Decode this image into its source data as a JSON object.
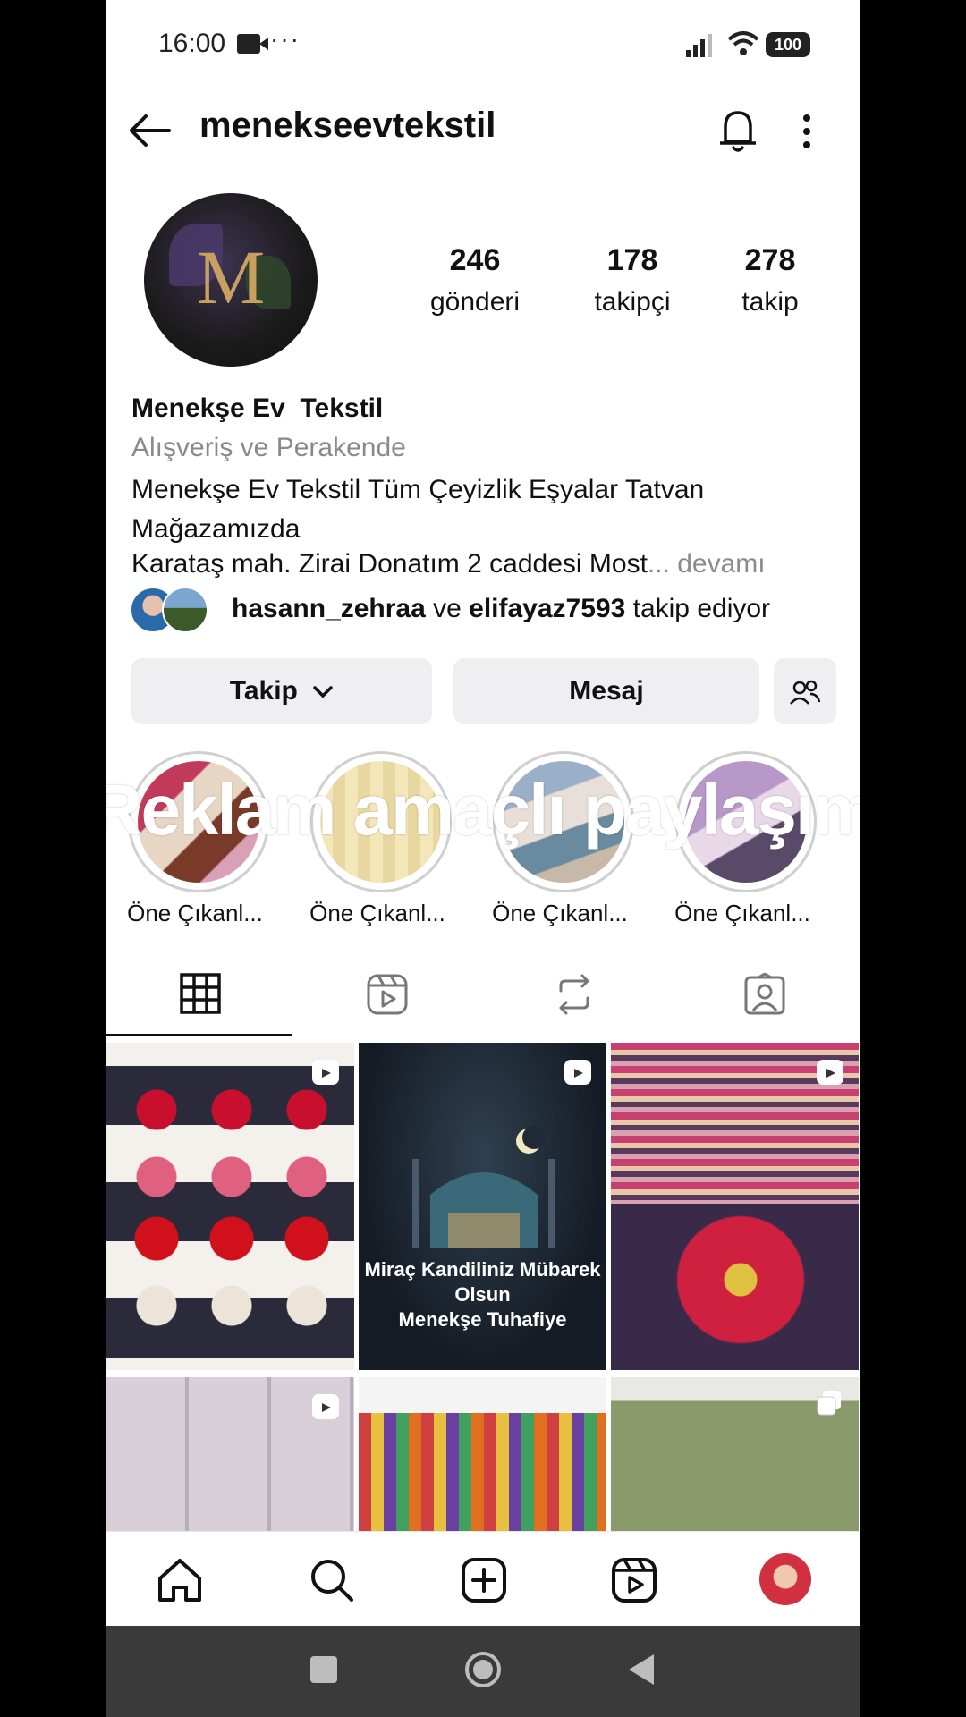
{
  "status_bar": {
    "time": "16:00",
    "dots": "···",
    "battery": "100"
  },
  "header": {
    "username": "menekseevtekstil"
  },
  "profile": {
    "avatar_letter": "M",
    "stats": [
      {
        "value": "246",
        "label": "gönderi"
      },
      {
        "value": "178",
        "label": "takipçi"
      },
      {
        "value": "278",
        "label": "takip"
      }
    ]
  },
  "bio": {
    "name": "Menekşe Ev  Tekstil",
    "category": "Alışveriş ve Perakende",
    "line1": "Menekşe Ev Tekstil Tüm Çeyizlik Eşyalar Tatvan Mağazamızda",
    "address": "Karataş mah. Zirai Donatım 2 caddesi Most",
    "more": "... devamı"
  },
  "followed_by": {
    "user1": "hasann_zehraa",
    "connector": " ve ",
    "user2": "elifayaz7593",
    "suffix": " takip ediyor"
  },
  "buttons": {
    "follow": "Takip",
    "message": "Mesaj"
  },
  "overlay_text": "Reklam amaçlı paylaşım",
  "highlights": [
    {
      "label": "Öne Çıkanl..."
    },
    {
      "label": "Öne Çıkanl..."
    },
    {
      "label": "Öne Çıkanl..."
    },
    {
      "label": "Öne Çıkanl..."
    }
  ],
  "posts": [
    {
      "caption": ""
    },
    {
      "caption": "Miraç Kandiliniz Mübarek Olsun\nMenekşe Tuhafiye"
    },
    {
      "caption": ""
    },
    {
      "caption": ""
    },
    {
      "caption": ""
    },
    {
      "caption": ""
    }
  ],
  "colors": {
    "muted": "#8a8a8a",
    "button_bg": "#efeff2",
    "text": "#111111"
  }
}
